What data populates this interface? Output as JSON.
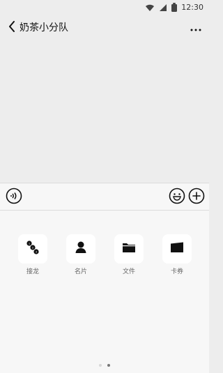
{
  "status_bar": {
    "time": "12:30",
    "icons": [
      "wifi-icon",
      "signal-icon",
      "battery-icon"
    ]
  },
  "header": {
    "back_icon": "chevron-left-icon",
    "title": "奶茶小分队",
    "more_icon": "more-icon"
  },
  "input_bar": {
    "voice_icon": "voice-icon",
    "emoji_icon": "emoji-icon",
    "add_icon": "plus-icon"
  },
  "tools": [
    {
      "label": "接龙",
      "icon": "relay-icon"
    },
    {
      "label": "名片",
      "icon": "contact-card-icon"
    },
    {
      "label": "文件",
      "icon": "folder-icon"
    },
    {
      "label": "卡券",
      "icon": "coupon-icon"
    }
  ],
  "pager": {
    "pages": 2,
    "active_page": 2
  },
  "colors": {
    "background": "#ededed",
    "panel": "#f7f7f7",
    "icon": "#111111",
    "label": "#666666"
  }
}
